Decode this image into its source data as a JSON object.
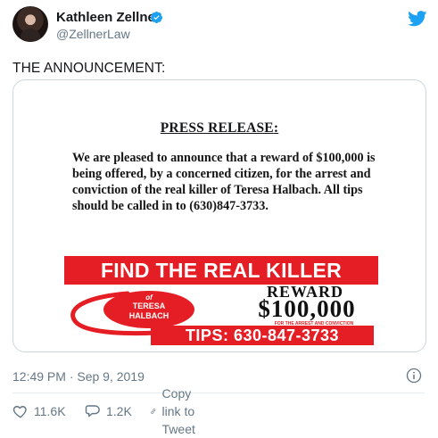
{
  "author": {
    "name": "Kathleen Zellner",
    "handle": "@ZellnerLaw",
    "verified": true
  },
  "tweet": {
    "text": "THE ANNOUNCEMENT:",
    "timestamp": "12:49 PM · Sep 9, 2019"
  },
  "media": {
    "title": "PRESS RELEASE",
    "title_suffix": ":",
    "body": "We are pleased to announce that a reward of $100,000 is being offered, by a concerned citizen, for the arrest and conviction of the real killer of Teresa Halbach. All tips should be called in to (630)847-3733.",
    "banner": "FIND THE REAL KILLER",
    "oval_of": "of",
    "oval_line1": "TERESA",
    "oval_line2": "HALBACH",
    "reward_label": "REWARD",
    "reward_amount": "$100,000",
    "reward_note": "FOR THE ARREST AND CONVICTION",
    "tips": "TIPS: 630-847-3733"
  },
  "actions": {
    "likes": "11.6K",
    "replies": "1.2K",
    "copy_link": "Copy link to Tweet"
  },
  "colors": {
    "accent": "#1da1f2",
    "red": "#e41e24",
    "muted": "#657786"
  },
  "icons": [
    "verified-badge-icon",
    "twitter-bird-icon",
    "info-icon",
    "heart-icon",
    "reply-icon",
    "link-icon"
  ]
}
